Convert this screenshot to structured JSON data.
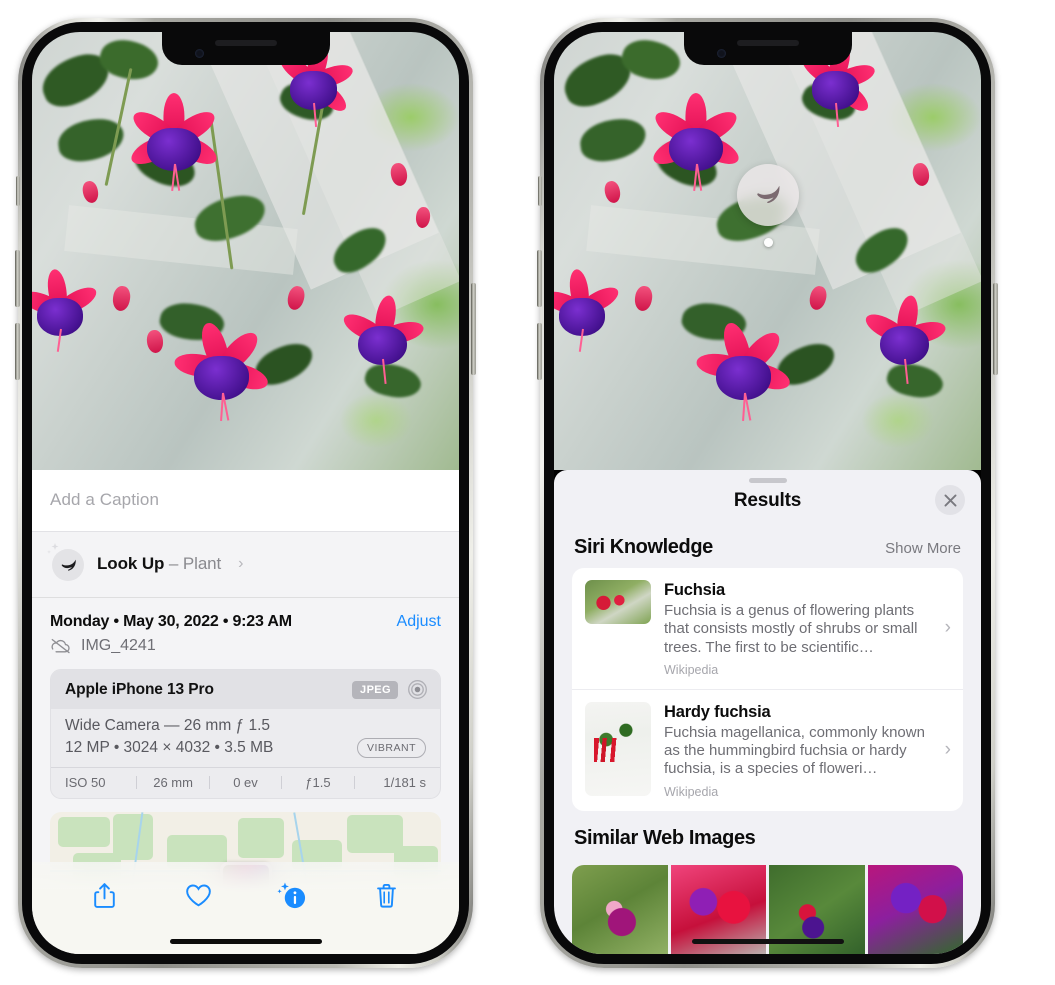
{
  "left_phone": {
    "photo": {
      "alt_name": "fuchsia-flowers-photo"
    },
    "caption": {
      "placeholder": "Add a Caption",
      "value": ""
    },
    "look_up": {
      "label": "Look Up",
      "dash": "–",
      "subject": "Plant",
      "chevron": "›",
      "icon": "leaf-icon"
    },
    "date_row": {
      "date": "Monday • May 30, 2022 • 9:23 AM",
      "adjust_label": "Adjust"
    },
    "file_row": {
      "icon": "cloud-slash-icon",
      "filename": "IMG_4241"
    },
    "exif": {
      "device": "Apple iPhone 13 Pro",
      "format_badge": "JPEG",
      "lens_icon": "aperture-icon",
      "lens_line": "Wide Camera — 26 mm ƒ 1.5",
      "size_line": "12 MP • 3024 × 4032 • 3.5 MB",
      "style_badge": "VIBRANT",
      "stats": [
        "ISO 50",
        "26 mm",
        "0 ev",
        "ƒ1.5",
        "1/181 s"
      ]
    },
    "toolbar": {
      "share_icon": "share-icon",
      "favorite_icon": "heart-icon",
      "info_icon": "sparkle-info-icon",
      "delete_icon": "trash-icon",
      "accent": "#1a8cff"
    }
  },
  "right_phone": {
    "badge": {
      "icon": "leaf-icon",
      "name": "visual-look-up-badge"
    },
    "sheet": {
      "title": "Results",
      "close_icon": "close-icon",
      "siri_knowledge": {
        "title": "Siri Knowledge",
        "show_more": "Show More",
        "cards": [
          {
            "title": "Fuchsia",
            "description": "Fuchsia is a genus of flowering plants that consists mostly of shrubs or small trees. The first to be scientific…",
            "source": "Wikipedia",
            "chevron": "›"
          },
          {
            "title": "Hardy fuchsia",
            "description": "Fuchsia magellanica, commonly known as the hummingbird fuchsia or hardy fuchsia, is a species of floweri…",
            "source": "Wikipedia",
            "chevron": "›"
          }
        ]
      },
      "similar_web_images": {
        "title": "Similar Web Images",
        "thumbnails": [
          "fuchsia-web-image-1",
          "fuchsia-web-image-2",
          "fuchsia-web-image-3",
          "fuchsia-web-image-4"
        ]
      }
    }
  }
}
